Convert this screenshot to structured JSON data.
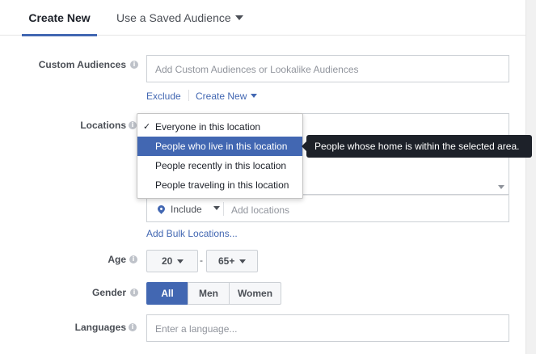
{
  "tabs": {
    "create_new": "Create New",
    "saved_audience": "Use a Saved Audience"
  },
  "custom_audiences": {
    "label": "Custom Audiences",
    "placeholder": "Add Custom Audiences or Lookalike Audiences",
    "exclude": "Exclude",
    "create_new": "Create New"
  },
  "locations": {
    "label": "Locations",
    "options": [
      "Everyone in this location",
      "People who live in this location",
      "People recently in this location",
      "People traveling in this location"
    ],
    "checked_index": 0,
    "highlighted_index": 1,
    "tooltip": "People whose home is within the selected area.",
    "include": "Include",
    "add_placeholder": "Add locations",
    "bulk": "Add Bulk Locations..."
  },
  "age": {
    "label": "Age",
    "min": "20",
    "max": "65+",
    "separator": "-"
  },
  "gender": {
    "label": "Gender",
    "options": [
      "All",
      "Men",
      "Women"
    ],
    "active": "All"
  },
  "languages": {
    "label": "Languages",
    "placeholder": "Enter a language..."
  },
  "icons": {
    "info": "i",
    "check": "✓"
  },
  "colors": {
    "accent": "#4267b2",
    "tooltip_bg": "#1d2129"
  }
}
